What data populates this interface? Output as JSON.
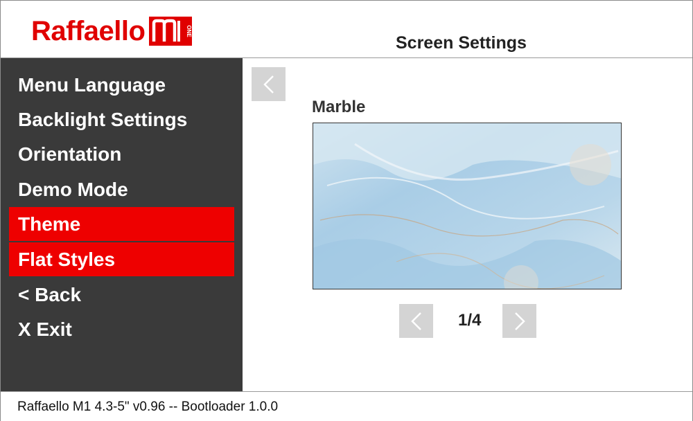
{
  "header": {
    "logo_text": "Raffaello",
    "logo_mark": "M1 ONE",
    "title": "Screen Settings",
    "brand_color": "#e00000"
  },
  "sidebar": {
    "items": [
      {
        "label": "Menu Language",
        "active": false
      },
      {
        "label": "Backlight Settings",
        "active": false
      },
      {
        "label": "Orientation",
        "active": false
      },
      {
        "label": "Demo Mode",
        "active": false
      },
      {
        "label": "Theme",
        "active": true
      },
      {
        "label": "Flat Styles",
        "active": true
      },
      {
        "label": "< Back",
        "active": false
      },
      {
        "label": "X Exit",
        "active": false
      }
    ],
    "active_color": "#ee0000",
    "background_color": "#3a3a3a"
  },
  "content": {
    "back_icon": "chevron-left-icon",
    "theme_name": "Marble",
    "pager": {
      "current": 1,
      "total": 4,
      "text": "1/4",
      "prev_icon": "chevron-left-icon",
      "next_icon": "chevron-right-icon"
    }
  },
  "footer": {
    "text": "Raffaello M1 4.3-5\" v0.96 -- Bootloader 1.0.0"
  }
}
